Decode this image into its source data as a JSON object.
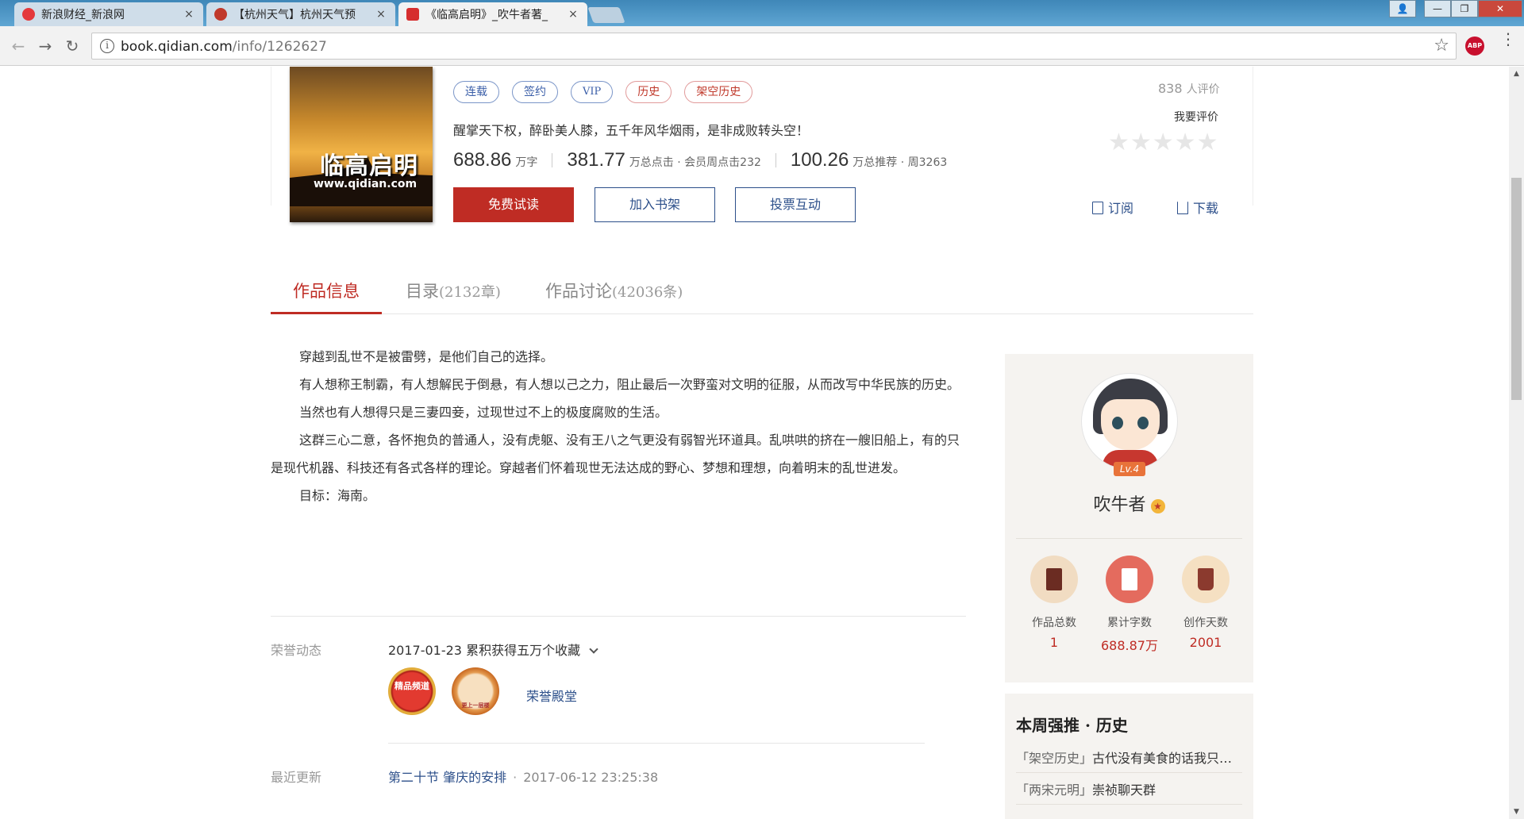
{
  "browser": {
    "tabs": [
      {
        "title": "新浪财经_新浪网",
        "close": "×",
        "favicon_color": "#e4393c"
      },
      {
        "title": "【杭州天气】杭州天气预",
        "close": "×",
        "favicon_color": "#c0392b"
      },
      {
        "title": "《临高启明》_吹牛者著_",
        "close": "×",
        "favicon_color": "#d62e2e"
      }
    ],
    "window_controls": {
      "minimize": "—",
      "maximize": "❐",
      "close": "✕",
      "user": "👤"
    },
    "back": "←",
    "forward": "→",
    "reload": "↻",
    "url_host": "book.qidian.com",
    "url_path": "/info/1262627",
    "info_icon": "i",
    "bookmark_icon": "☆",
    "adblock_label": "ABP",
    "menu_icon": "⋮"
  },
  "book": {
    "cover_title": "临高启明",
    "cover_site": "www.qidian.com",
    "tags": [
      {
        "label": "连载",
        "color": "blue"
      },
      {
        "label": "签约",
        "color": "blue"
      },
      {
        "label": "VIP",
        "color": "blue"
      },
      {
        "label": "历史",
        "color": "red"
      },
      {
        "label": "架空历史",
        "color": "red"
      }
    ],
    "intro": "醒掌天下权，醉卧美人膝，五千年风华烟雨，是非成败转头空！",
    "stats": {
      "words_num": "688.86",
      "words_unit": "万字",
      "clicks_num": "381.77",
      "clicks_unit": "万总点击 · 会员周点击232",
      "recommend_num": "100.26",
      "recommend_unit": "万总推荐 · 周3263"
    },
    "buttons": {
      "read": "免费试读",
      "shelf": "加入书架",
      "vote": "投票互动"
    },
    "rating": {
      "count": "838",
      "count_suffix": "人评价",
      "rate_me": "我要评价",
      "stars": "★★★★★"
    },
    "subscribe": "订阅",
    "download": "下载"
  },
  "tabs": [
    {
      "label": "作品信息",
      "count": ""
    },
    {
      "label": "目录",
      "count": "(2132章)"
    },
    {
      "label": "作品讨论",
      "count": "(42036条)"
    }
  ],
  "description": [
    "穿越到乱世不是被雷劈，是他们自己的选择。",
    "有人想称王制霸，有人想解民于倒悬，有人想以己之力，阻止最后一次野蛮对文明的征服，从而改写中华民族的历史。",
    "当然也有人想得只是三妻四妾，过现世过不上的极度腐败的生活。",
    "这群三心二意，各怀抱负的普通人，没有虎躯、没有王八之气更没有弱智光环道具。乱哄哄的挤在一艘旧船上，有的只是现代机器、科技还有各式各样的理论。穿越者们怀着现世无法达成的野心、梦想和理想，向着明末的乱世进发。",
    "目标：海南。"
  ],
  "honor": {
    "label": "荣誉动态",
    "date": "2017-01-23",
    "text": "累积获得五万个收藏",
    "medal1": "精品频道",
    "medal2": "更上一层楼",
    "link": "荣誉殿堂"
  },
  "latest": {
    "label": "最近更新",
    "chapter": "第二十节  肇庆的安排",
    "time": "2017-06-12 23:25:38"
  },
  "author": {
    "level": "Lv.4",
    "name": "吹牛者",
    "badge": "★",
    "stats": [
      {
        "label": "作品总数",
        "value": "1",
        "color": "#8b3a2e",
        "bg": "#f1dcc2"
      },
      {
        "label": "累计字数",
        "value": "688.87万",
        "color": "#fff",
        "bg": "#e46b5e"
      },
      {
        "label": "创作天数",
        "value": "2001",
        "color": "#8b3a2e",
        "bg": "#f5e0c2"
      }
    ]
  },
  "weekly": {
    "title": "本周强推 · 历史",
    "items": [
      {
        "cat": "「架空历史」",
        "title": "古代没有美食的话我只…"
      },
      {
        "cat": "「两宋元明」",
        "title": "崇祯聊天群"
      }
    ]
  }
}
